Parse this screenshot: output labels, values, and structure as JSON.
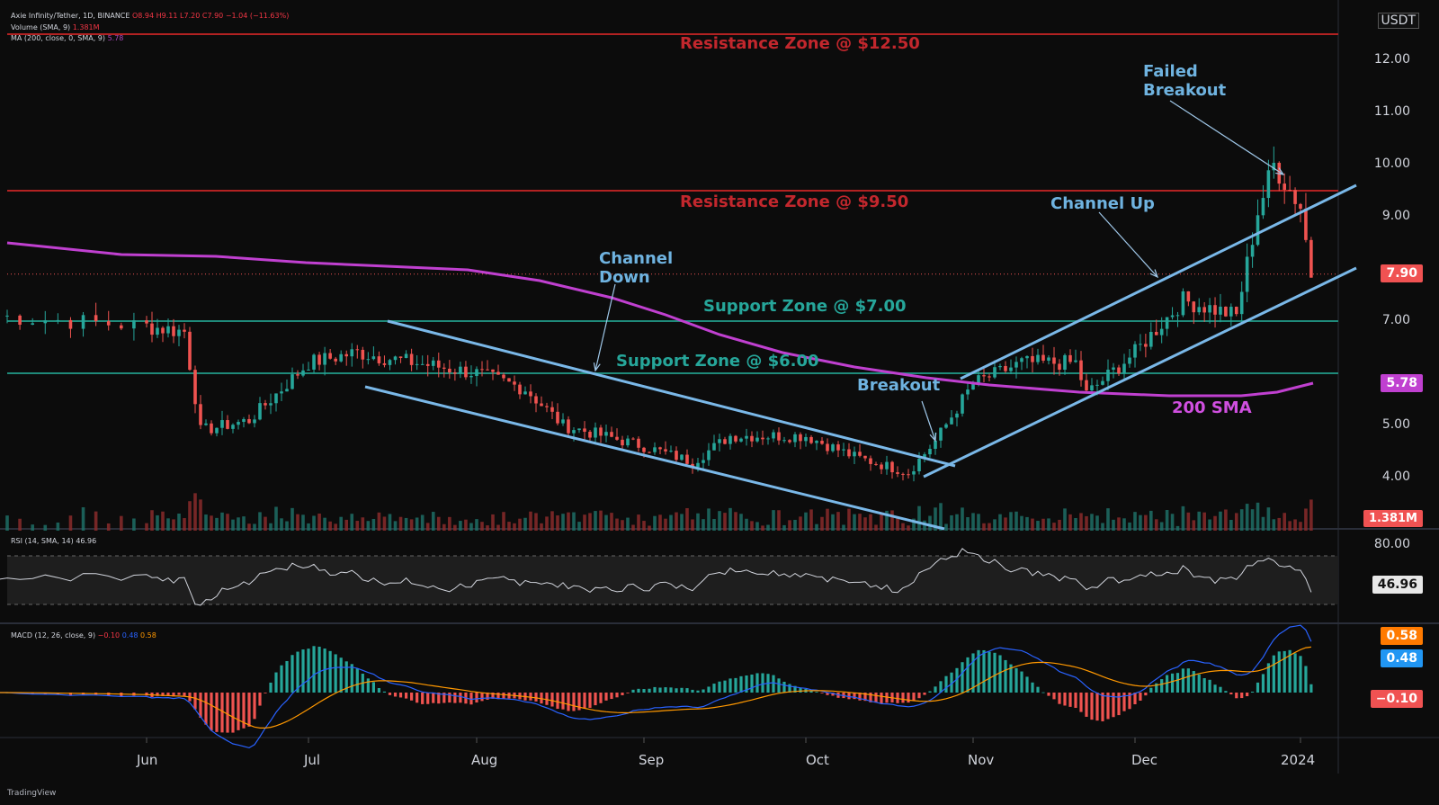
{
  "header": {
    "symbol_line": "Axie Infinity/Tether, 1D, BINANCE",
    "o": "O8.94",
    "h": "H9.11",
    "l": "L7.20",
    "c": "C7.90",
    "chg": "−1.04 (−11.63%)",
    "volume_line": "Volume (SMA, 9)",
    "volume_val": "1.381M",
    "ma_line": "MA (200, close, 0, SMA, 9)",
    "ma_val": "5.78",
    "rsi_line": "RSI (14, SMA, 14)",
    "rsi_val": "46.96",
    "macd_line": "MACD (12, 26, close, 9)",
    "macd_a": "−0.10",
    "macd_b": "0.48",
    "macd_c": "0.58"
  },
  "unit": "USDT",
  "brand": "TradingView",
  "price_axis": [
    "12.00",
    "11.00",
    "10.00",
    "9.00",
    "7.00",
    "5.00",
    "4.00"
  ],
  "time_axis": [
    "Jun",
    "Jul",
    "Aug",
    "Sep",
    "Oct",
    "Nov",
    "Dec",
    "2024"
  ],
  "rsi_axis": [
    "80.00"
  ],
  "labels": {
    "last_price": "7.90",
    "sma_value": "5.78",
    "volume_value": "1.381M",
    "rsi_value": "46.96",
    "macd_1": "0.58",
    "macd_2": "0.48",
    "macd_3": "−0.10"
  },
  "annotations": {
    "res_1250": "Resistance Zone @ $12.50",
    "res_950": "Resistance Zone @ $9.50",
    "sup_700": "Support Zone @ $7.00",
    "sup_600": "Support Zone @ $6.00",
    "channel_down": "Channel\nDown",
    "channel_up": "Channel Up",
    "breakout": "Breakout",
    "failed_breakout": "Failed\nBreakout",
    "sma200": "200 SMA"
  },
  "colors": {
    "up": "#26a69a",
    "down": "#ef5350",
    "sma": "#c040d0",
    "resistance": "#b22222",
    "support": "#1f8a7a",
    "channel": "#7ab8e8",
    "macd": "#2962ff",
    "signal": "#ff9800"
  },
  "chart_data": {
    "type": "candlestick",
    "title": "Axie Infinity/Tether, 1D, BINANCE",
    "ylabel": "USDT",
    "ylim": [
      3.0,
      13.0
    ],
    "levels": [
      {
        "name": "Resistance Zone @ $12.50",
        "value": 12.5
      },
      {
        "name": "Resistance Zone @ $9.50",
        "value": 9.5
      },
      {
        "name": "Support Zone @ $7.00",
        "value": 7.0
      },
      {
        "name": "Support Zone @ $6.00",
        "value": 6.0
      }
    ],
    "sma200_last": 5.78,
    "last_close": 7.9,
    "rsi_last": 46.96,
    "volume_last": "1.381M",
    "close_path": [
      [
        "May 20",
        7.1
      ],
      [
        "Jun 1",
        6.9
      ],
      [
        "Jun 8",
        6.8
      ],
      [
        "Jun 11",
        4.9
      ],
      [
        "Jun 20",
        5.1
      ],
      [
        "Jul 1",
        6.2
      ],
      [
        "Jul 10",
        6.4
      ],
      [
        "Jul 15",
        6.3
      ],
      [
        "Aug 1",
        6.0
      ],
      [
        "Aug 10",
        5.7
      ],
      [
        "Aug 17",
        5.0
      ],
      [
        "Sep 1",
        4.6
      ],
      [
        "Sep 10",
        4.3
      ],
      [
        "Sep 17",
        4.8
      ],
      [
        "Oct 1",
        4.8
      ],
      [
        "Oct 10",
        4.4
      ],
      [
        "Oct 20",
        4.1
      ],
      [
        "Oct 25",
        4.7
      ],
      [
        "Nov 1",
        5.8
      ],
      [
        "Nov 10",
        6.2
      ],
      [
        "Nov 20",
        6.2
      ],
      [
        "Nov 22",
        5.6
      ],
      [
        "Dec 1",
        6.4
      ],
      [
        "Dec 10",
        7.4
      ],
      [
        "Dec 20",
        7.1
      ],
      [
        "Dec 24",
        9.1
      ],
      [
        "Dec 27",
        10.0
      ],
      [
        "Jan 1",
        9.2
      ],
      [
        "Jan 3",
        7.9
      ]
    ]
  }
}
